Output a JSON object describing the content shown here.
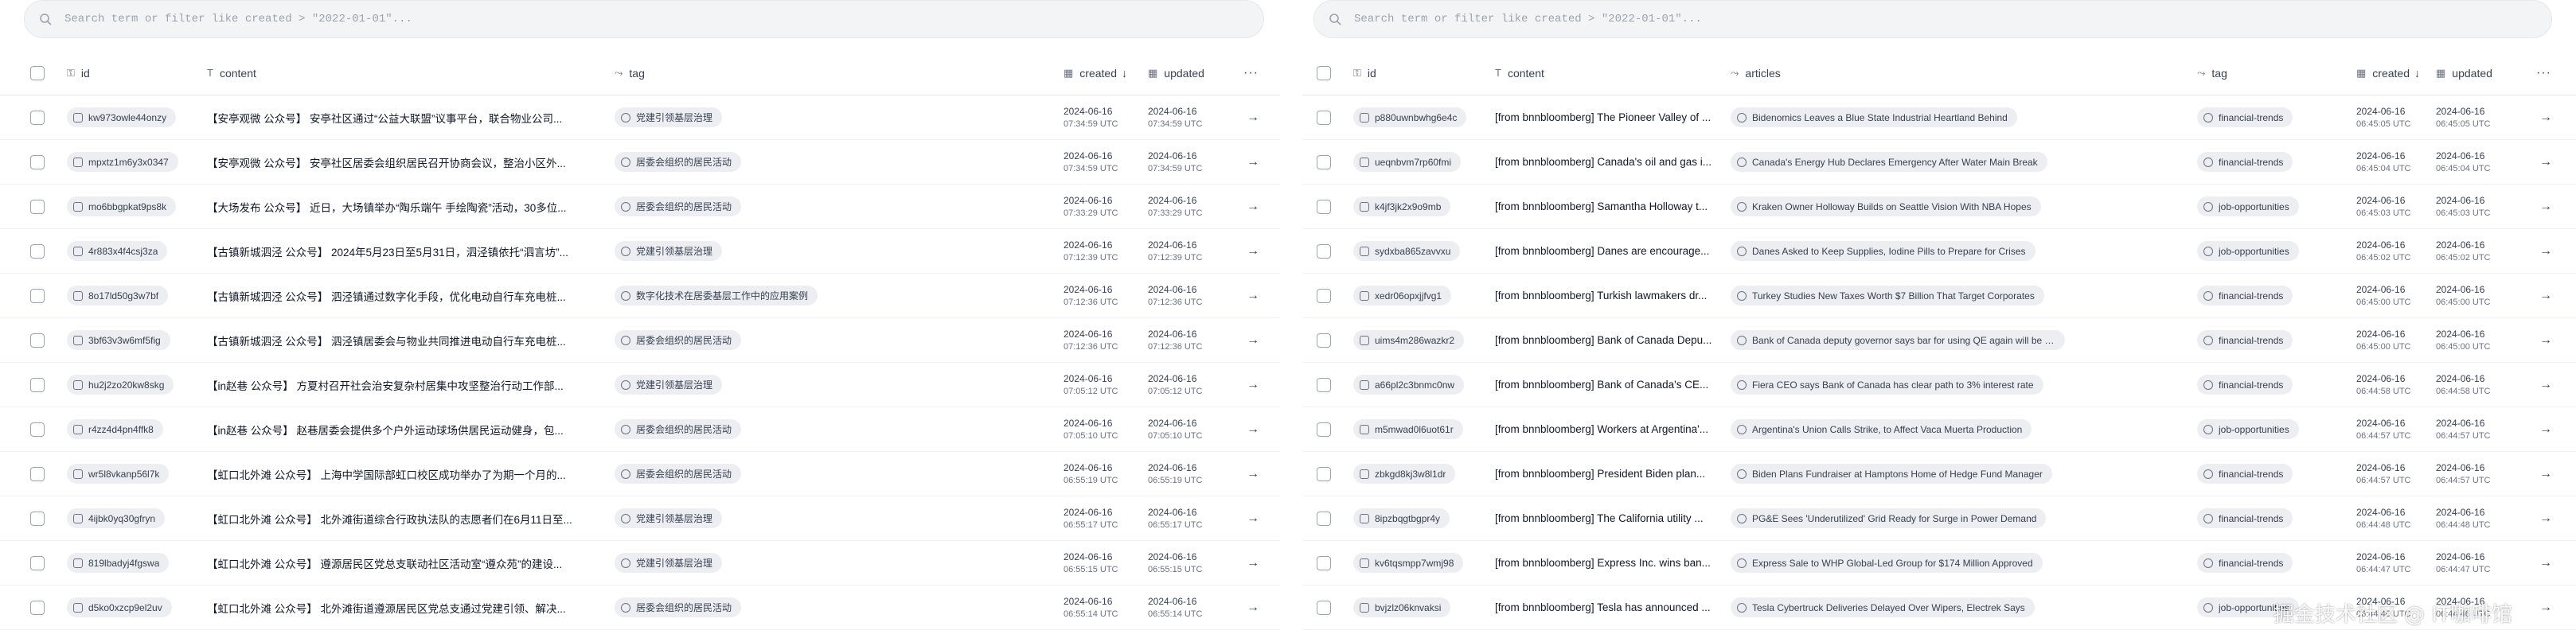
{
  "left": {
    "search_placeholder": "Search term or filter like created > \"2022-01-01\"...",
    "headers": {
      "id": "id",
      "content": "content",
      "tag": "tag",
      "created": "created",
      "updated": "updated",
      "more": "···"
    },
    "rows": [
      {
        "id": "kw973owle44onzy",
        "content": "【安亭观微 公众号】 安亭社区通过“公益大联盟”议事平台，联合物业公司...",
        "tag": "党建引领基层治理",
        "created_date": "2024-06-16",
        "created_time": "07:34:59 UTC",
        "updated_date": "2024-06-16",
        "updated_time": "07:34:59 UTC"
      },
      {
        "id": "mpxtz1m6y3x0347",
        "content": "【安亭观微 公众号】 安亭社区居委会组织居民召开协商会议，整治小区外...",
        "tag": "居委会组织的居民活动",
        "created_date": "2024-06-16",
        "created_time": "07:34:59 UTC",
        "updated_date": "2024-06-16",
        "updated_time": "07:34:59 UTC"
      },
      {
        "id": "mo6bbgpkat9ps8k",
        "content": "【大场发布 公众号】 近日，大场镇举办“陶乐端午 手绘陶瓷”活动，30多位...",
        "tag": "居委会组织的居民活动",
        "created_date": "2024-06-16",
        "created_time": "07:33:29 UTC",
        "updated_date": "2024-06-16",
        "updated_time": "07:33:29 UTC"
      },
      {
        "id": "4r883x4f4csj3za",
        "content": "【古镇新城泗泾 公众号】 2024年5月23日至5月31日，泗泾镇依托“泗言坊”...",
        "tag": "党建引领基层治理",
        "created_date": "2024-06-16",
        "created_time": "07:12:39 UTC",
        "updated_date": "2024-06-16",
        "updated_time": "07:12:39 UTC"
      },
      {
        "id": "8o17ld50g3w7bf",
        "content": "【古镇新城泗泾 公众号】 泗泾镇通过数字化手段，优化电动自行车充电桩...",
        "tag": "数字化技术在居委基层工作中的应用案例",
        "created_date": "2024-06-16",
        "created_time": "07:12:36 UTC",
        "updated_date": "2024-06-16",
        "updated_time": "07:12:36 UTC"
      },
      {
        "id": "3bf63v3w6mf5fig",
        "content": "【古镇新城泗泾 公众号】 泗泾镇居委会与物业共同推进电动自行车充电桩...",
        "tag": "居委会组织的居民活动",
        "created_date": "2024-06-16",
        "created_time": "07:12:36 UTC",
        "updated_date": "2024-06-16",
        "updated_time": "07:12:36 UTC"
      },
      {
        "id": "hu2j2zo20kw8skg",
        "content": "【in赵巷 公众号】 方夏村召开社会治安复杂村居集中攻坚整治行动工作部...",
        "tag": "党建引领基层治理",
        "created_date": "2024-06-16",
        "created_time": "07:05:12 UTC",
        "updated_date": "2024-06-16",
        "updated_time": "07:05:12 UTC"
      },
      {
        "id": "r4zz4d4pn4ffk8",
        "content": "【in赵巷 公众号】 赵巷居委会提供多个户外运动球场供居民运动健身，包...",
        "tag": "居委会组织的居民活动",
        "created_date": "2024-06-16",
        "created_time": "07:05:10 UTC",
        "updated_date": "2024-06-16",
        "updated_time": "07:05:10 UTC"
      },
      {
        "id": "wr5l8vkanp56l7k",
        "content": "【虹口北外滩 公众号】 上海中学国际部虹口校区成功举办了为期一个月的...",
        "tag": "居委会组织的居民活动",
        "created_date": "2024-06-16",
        "created_time": "06:55:19 UTC",
        "updated_date": "2024-06-16",
        "updated_time": "06:55:19 UTC"
      },
      {
        "id": "4ijbk0yq30gfryn",
        "content": "【虹口北外滩 公众号】 北外滩街道综合行政执法队的志愿者们在6月11日至...",
        "tag": "党建引领基层治理",
        "created_date": "2024-06-16",
        "created_time": "06:55:17 UTC",
        "updated_date": "2024-06-16",
        "updated_time": "06:55:17 UTC"
      },
      {
        "id": "819lbadyj4fgswa",
        "content": "【虹口北外滩 公众号】 遵源居民区党总支联动社区活动室“遵众苑”的建设...",
        "tag": "党建引领基层治理",
        "created_date": "2024-06-16",
        "created_time": "06:55:15 UTC",
        "updated_date": "2024-06-16",
        "updated_time": "06:55:15 UTC"
      },
      {
        "id": "d5ko0xzcp9el2uv",
        "content": "【虹口北外滩 公众号】 北外滩街道遵源居民区党总支通过党建引领、解决...",
        "tag": "居委会组织的居民活动",
        "created_date": "2024-06-16",
        "created_time": "06:55:14 UTC",
        "updated_date": "2024-06-16",
        "updated_time": "06:55:14 UTC"
      }
    ]
  },
  "right": {
    "search_placeholder": "Search term or filter like created > \"2022-01-01\"...",
    "headers": {
      "id": "id",
      "content": "content",
      "articles": "articles",
      "tag": "tag",
      "created": "created",
      "updated": "updated",
      "more": "···"
    },
    "rows": [
      {
        "id": "p880uwnbwhg6e4c",
        "content": "[from bnnbloomberg] The Pioneer Valley of ...",
        "article": "Bidenomics Leaves a Blue State Industrial Heartland Behind",
        "tag": "financial-trends",
        "created_date": "2024-06-16",
        "created_time": "06:45:05 UTC",
        "updated_date": "2024-06-16",
        "updated_time": "06:45:05 UTC"
      },
      {
        "id": "ueqnbvm7rp60fmi",
        "content": "[from bnnbloomberg] Canada's oil and gas i...",
        "article": "Canada's Energy Hub Declares Emergency After Water Main Break",
        "tag": "financial-trends",
        "created_date": "2024-06-16",
        "created_time": "06:45:04 UTC",
        "updated_date": "2024-06-16",
        "updated_time": "06:45:04 UTC"
      },
      {
        "id": "k4jf3jk2x9o9mb",
        "content": "[from bnnbloomberg] Samantha Holloway t...",
        "article": "Kraken Owner Holloway Builds on Seattle Vision With NBA Hopes",
        "tag": "job-opportunities",
        "created_date": "2024-06-16",
        "created_time": "06:45:03 UTC",
        "updated_date": "2024-06-16",
        "updated_time": "06:45:03 UTC"
      },
      {
        "id": "sydxba865zavvxu",
        "content": "[from bnnbloomberg] Danes are encourage...",
        "article": "Danes Asked to Keep Supplies, Iodine Pills to Prepare for Crises",
        "tag": "job-opportunities",
        "created_date": "2024-06-16",
        "created_time": "06:45:02 UTC",
        "updated_date": "2024-06-16",
        "updated_time": "06:45:02 UTC"
      },
      {
        "id": "xedr06opxjjfvg1",
        "content": "[from bnnbloomberg] Turkish lawmakers dr...",
        "article": "Turkey Studies New Taxes Worth $7 Billion That Target Corporates",
        "tag": "financial-trends",
        "created_date": "2024-06-16",
        "created_time": "06:45:00 UTC",
        "updated_date": "2024-06-16",
        "updated_time": "06:45:00 UTC"
      },
      {
        "id": "uims4m286wazkr2",
        "content": "[from bnnbloomberg] Bank of Canada Depu...",
        "article": "Bank of Canada deputy governor says bar for using QE again will be ver...",
        "tag": "financial-trends",
        "created_date": "2024-06-16",
        "created_time": "06:45:00 UTC",
        "updated_date": "2024-06-16",
        "updated_time": "06:45:00 UTC"
      },
      {
        "id": "a66pl2c3bnmc0nw",
        "content": "[from bnnbloomberg] Bank of Canada's CE...",
        "article": "Fiera CEO says Bank of Canada has clear path to 3% interest rate",
        "tag": "financial-trends",
        "created_date": "2024-06-16",
        "created_time": "06:44:58 UTC",
        "updated_date": "2024-06-16",
        "updated_time": "06:44:58 UTC"
      },
      {
        "id": "m5mwad0l6uot61r",
        "content": "[from bnnbloomberg] Workers at Argentina'...",
        "article": "Argentina's Union Calls Strike, to Affect Vaca Muerta Production",
        "tag": "job-opportunities",
        "created_date": "2024-06-16",
        "created_time": "06:44:57 UTC",
        "updated_date": "2024-06-16",
        "updated_time": "06:44:57 UTC"
      },
      {
        "id": "zbkgd8kj3w8l1dr",
        "content": "[from bnnbloomberg] President Biden plan...",
        "article": "Biden Plans Fundraiser at Hamptons Home of Hedge Fund Manager",
        "tag": "financial-trends",
        "created_date": "2024-06-16",
        "created_time": "06:44:57 UTC",
        "updated_date": "2024-06-16",
        "updated_time": "06:44:57 UTC"
      },
      {
        "id": "8ipzbqgtbgpr4y",
        "content": "[from bnnbloomberg] The California utility ...",
        "article": "PG&E Sees 'Underutilized' Grid Ready for Surge in Power Demand",
        "tag": "financial-trends",
        "created_date": "2024-06-16",
        "created_time": "06:44:48 UTC",
        "updated_date": "2024-06-16",
        "updated_time": "06:44:48 UTC"
      },
      {
        "id": "kv6tqsmpp7wmj98",
        "content": "[from bnnbloomberg] Express Inc. wins ban...",
        "article": "Express Sale to WHP Global-Led Group for $174 Million Approved",
        "tag": "financial-trends",
        "created_date": "2024-06-16",
        "created_time": "06:44:47 UTC",
        "updated_date": "2024-06-16",
        "updated_time": "06:44:47 UTC"
      },
      {
        "id": "bvjzlz06knvaksi",
        "content": "[from bnnbloomberg] Tesla has announced ...",
        "article": "Tesla Cybertruck Deliveries Delayed Over Wipers, Electrek Says",
        "tag": "job-opportunities",
        "created_date": "2024-06-16",
        "created_time": "06:44:46 UTC",
        "updated_date": "2024-06-16",
        "updated_time": "06:44:46 UTC"
      }
    ]
  },
  "watermark": "掘金技术社区 @ IT咖啡馆"
}
